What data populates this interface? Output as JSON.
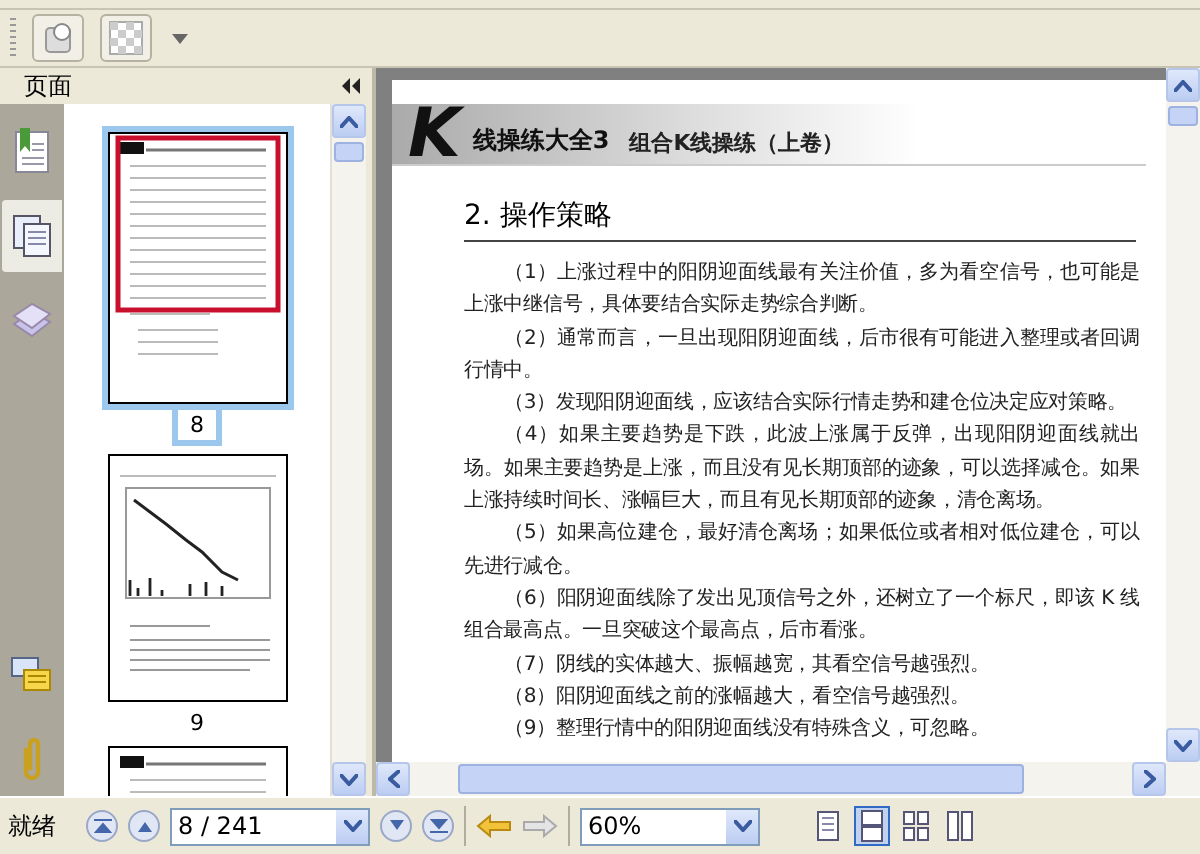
{
  "sidebar": {
    "title": "页面",
    "thumbnails": [
      {
        "label": "8",
        "selected": true,
        "kind": "text"
      },
      {
        "label": "9",
        "selected": false,
        "kind": "chart"
      },
      {
        "selected": false,
        "kind": "text"
      }
    ]
  },
  "document": {
    "logo": "K",
    "series_title": "线操练大全3",
    "book_title": "组合K线操练（上卷）",
    "heading": "2. 操作策略",
    "paragraphs": [
      "（1）上涨过程中的阳阴迎面线最有关注价值，多为看空信号，也可能是上涨中继信号，具体要结合实际走势综合判断。",
      "（2）通常而言，一旦出现阳阴迎面线，后市很有可能进入整理或者回调行情中。",
      "（3）发现阳阴迎面线，应该结合实际行情走势和建仓位决定应对策略。",
      "（4）如果主要趋势是下跌，此波上涨属于反弹，出现阳阴迎面线就出场。如果主要趋势是上涨，而且没有见长期顶部的迹象，可以选择减仓。如果上涨持续时间长、涨幅巨大，而且有见长期顶部的迹象，清仓离场。",
      "（5）如果高位建仓，最好清仓离场；如果低位或者相对低位建仓，可以先进行减仓。",
      "（6）阳阴迎面线除了发出见顶信号之外，还树立了一个标尺，即该 K 线组合最高点。一旦突破这个最高点，后市看涨。",
      "（7）阴线的实体越大、振幅越宽，其看空信号越强烈。",
      "（8）阳阴迎面线之前的涨幅越大，看空信号越强烈。",
      "（9）整理行情中的阳阴迎面线没有特殊含义，可忽略。"
    ]
  },
  "status_bar": {
    "status": "就绪",
    "page_field": "8 / 241",
    "zoom_field": "60%",
    "view_modes": [
      {
        "selected": false
      },
      {
        "selected": true
      },
      {
        "selected": false
      },
      {
        "selected": false
      }
    ]
  }
}
